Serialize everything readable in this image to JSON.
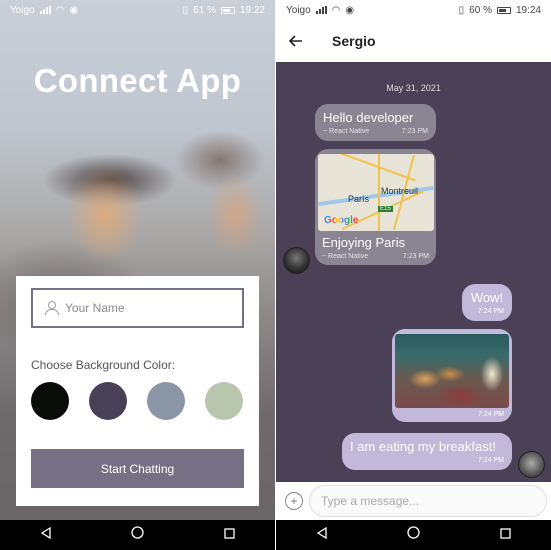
{
  "left": {
    "status": {
      "carrier": "Yoigo",
      "battery": "61 %",
      "time": "19:22"
    },
    "app_title": "Connect App",
    "name_placeholder": "Your Name",
    "bg_label": "Choose Background Color:",
    "swatch_colors": [
      "#090C08",
      "#474056",
      "#8A95A5",
      "#B9C6AE"
    ],
    "start_button": "Start Chatting"
  },
  "right": {
    "status": {
      "carrier": "Yoigo",
      "battery": "60 %",
      "time": "19:24"
    },
    "chat_title": "Sergio",
    "date": "May 31, 2021",
    "messages": [
      {
        "text": "Hello developer",
        "sender": "React Native",
        "time": "7:23 PM"
      },
      {
        "text": "Enjoying Paris",
        "sender": "React Native",
        "time": "7:23 PM",
        "map_labels": [
          "París",
          "Montreuil",
          "E15"
        ]
      },
      {
        "text": "Wow!",
        "time": "7:24 PM"
      },
      {
        "time": "7:24 PM"
      },
      {
        "text": "I am eating my breakfast!",
        "time": "7:24 PM"
      }
    ],
    "input_placeholder": "Type a message...",
    "google_logo": "Google",
    "bubble_colors": {
      "left": "#8A8593",
      "right": "#C2B8DA",
      "chat_bg": "#4A4156"
    }
  }
}
